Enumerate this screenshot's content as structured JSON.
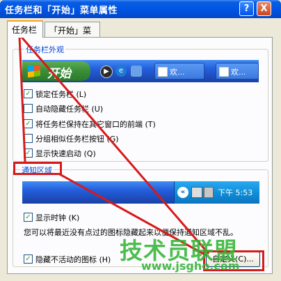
{
  "window": {
    "title": "任务栏和「开始」菜单属性",
    "help_label": "?",
    "close_label": "X"
  },
  "tabs": [
    {
      "label": "任务栏",
      "selected": true
    },
    {
      "label": "「开始」菜单",
      "selected": false
    }
  ],
  "appearance": {
    "group_label": "任务栏外观",
    "preview": {
      "start_label": "开始",
      "quick_launch_icons": [
        "media-player-icon",
        "ie-icon",
        "show-desktop-icon"
      ],
      "task_buttons": [
        "欢...",
        "欢..."
      ]
    },
    "checkboxes": [
      {
        "label": "锁定任务栏 (L)",
        "checked": true
      },
      {
        "label": "自动隐藏任务栏 (U)",
        "checked": false
      },
      {
        "label": "将任务栏保持在其它窗口的前端 (T)",
        "checked": true
      },
      {
        "label": "分组相似任务栏按钮 (G)",
        "checked": false
      },
      {
        "label": "显示快速启动 (Q)",
        "checked": true
      }
    ]
  },
  "notification": {
    "group_label": "通知区域",
    "preview": {
      "chevron": "«",
      "time": "下午 5:53"
    },
    "show_clock": {
      "label": "显示时钟 (K)",
      "checked": true
    },
    "description": "您可以将最近没有点过的图标隐藏起来以便保持通知区域不乱。",
    "hide_inactive": {
      "label": "隐藏不活动的图标 (H)",
      "checked": true
    },
    "customize_label": "自定义(C)..."
  },
  "annotation_color": "#d61a1a",
  "watermark": {
    "text": "技术员联盟",
    "url": "www.jsgho.com",
    "color": "#34b536"
  }
}
